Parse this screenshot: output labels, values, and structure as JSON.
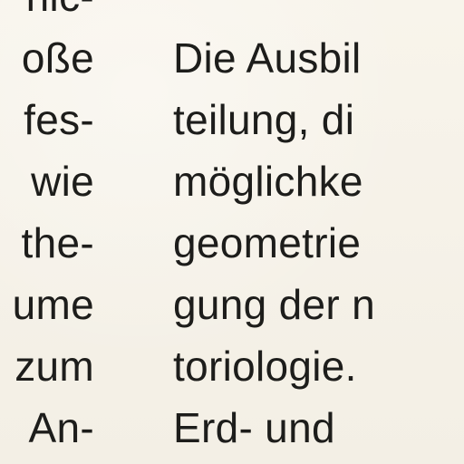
{
  "document": {
    "left_column_lines": [
      "nic-",
      "oße",
      "fes-",
      "wie",
      "the-",
      "ume",
      "zum",
      "An-"
    ],
    "right_column_lines": [
      "",
      "Die Ausbil",
      "teilung, di",
      "möglichke",
      "geometrie",
      "gung der n",
      "toriologie.",
      "Erd- und"
    ]
  }
}
